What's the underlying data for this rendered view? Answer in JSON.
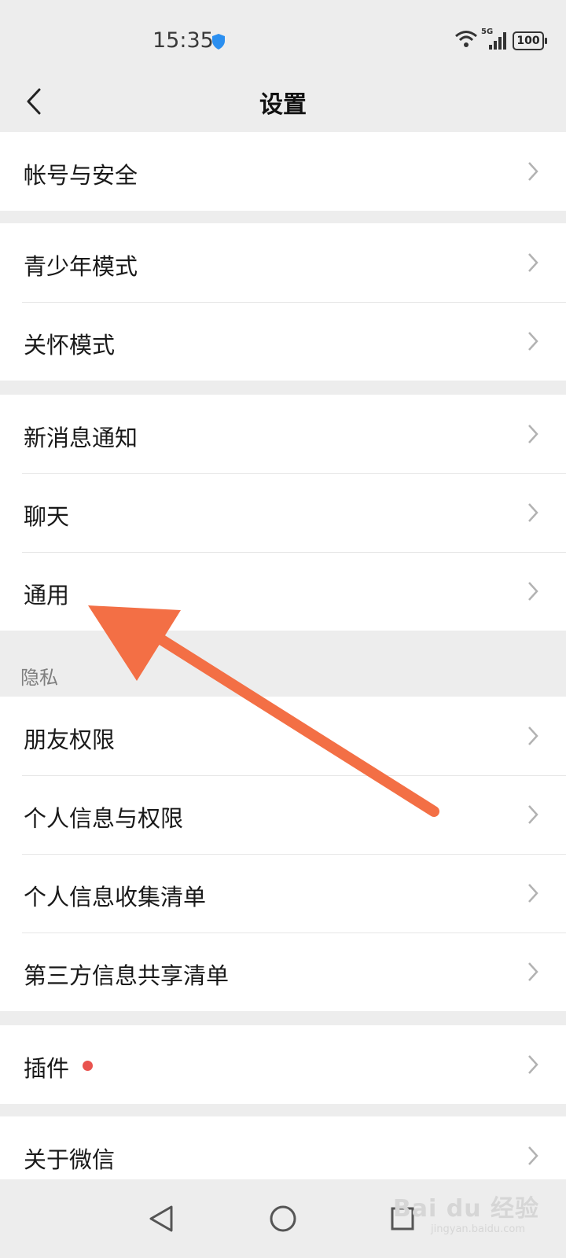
{
  "status_bar": {
    "time": "15:35",
    "network": "5G",
    "battery": "100",
    "icons": [
      "shield-icon",
      "wifi-icon",
      "signal-icon",
      "battery-icon"
    ]
  },
  "nav": {
    "title": "设置",
    "back_icon": "chevron-left-icon"
  },
  "groups": [
    {
      "items": [
        {
          "label": "帐号与安全"
        }
      ]
    },
    {
      "items": [
        {
          "label": "青少年模式"
        },
        {
          "label": "关怀模式"
        }
      ]
    },
    {
      "items": [
        {
          "label": "新消息通知"
        },
        {
          "label": "聊天"
        },
        {
          "label": "通用"
        }
      ]
    },
    {
      "header": "隐私",
      "items": [
        {
          "label": "朋友权限"
        },
        {
          "label": "个人信息与权限"
        },
        {
          "label": "个人信息收集清单"
        },
        {
          "label": "第三方信息共享清单"
        }
      ]
    },
    {
      "items": [
        {
          "label": "插件",
          "badge": "red-dot"
        }
      ]
    },
    {
      "items": [
        {
          "label": "关于微信"
        }
      ]
    }
  ],
  "annotation": {
    "type": "arrow",
    "color": "#f36f45",
    "points_to": "通用"
  },
  "system_nav": {
    "buttons": [
      "back-triangle-icon",
      "home-circle-icon",
      "recents-square-icon"
    ]
  },
  "watermark": {
    "text": "Bai du 经验",
    "sub": "jingyan.baidu.com"
  },
  "colors": {
    "background": "#ededed",
    "row": "#ffffff",
    "accent_red": "#e9534f"
  }
}
